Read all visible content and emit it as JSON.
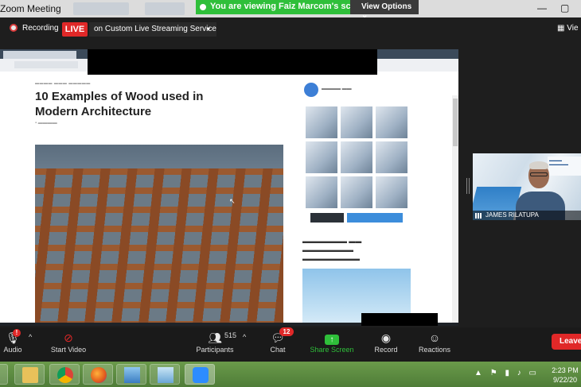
{
  "app": {
    "title": "Zoom Meeting",
    "share_banner": "You are viewing Faiz Marcom's screen",
    "view_options": "View Options"
  },
  "meeting": {
    "recording": "Recording",
    "live": "LIVE",
    "live_service": "on Custom Live Streaming Service",
    "view_button": "Vie"
  },
  "shared_screen": {
    "headline": "10 Examples of Wood used in Modern Architecture"
  },
  "participant": {
    "name": "JAMES RILATUPA"
  },
  "toolbar": {
    "audio_label": "Audio",
    "audio_badge": "!",
    "video_label": "Start Video",
    "participants_label": "Participants",
    "participants_count": "515",
    "chat_label": "Chat",
    "chat_badge": "12",
    "share_label": "Share Screen",
    "record_label": "Record",
    "reactions_label": "Reactions",
    "leave_label": "Leave"
  },
  "taskbar": {
    "time": "2:23 PM",
    "date": "9/22/20"
  },
  "colors": {
    "live_red": "#e02828",
    "share_green": "#2fbf3a",
    "taskbar_green": "#5b8b40"
  }
}
